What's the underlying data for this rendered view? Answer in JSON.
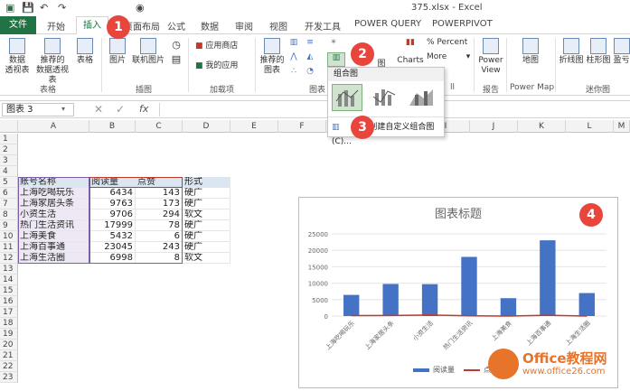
{
  "window": {
    "title": "375.xlsx - Excel"
  },
  "tabs": [
    {
      "label": "文件",
      "key": "file"
    },
    {
      "label": "开始",
      "key": "home"
    },
    {
      "label": "插入",
      "key": "insert"
    },
    {
      "label": "页面布局",
      "key": "layout"
    },
    {
      "label": "公式",
      "key": "formulas"
    },
    {
      "label": "数据",
      "key": "data"
    },
    {
      "label": "审阅",
      "key": "review"
    },
    {
      "label": "视图",
      "key": "view"
    },
    {
      "label": "开发工具",
      "key": "dev"
    },
    {
      "label": "POWER QUERY",
      "key": "pq"
    },
    {
      "label": "POWERPIVOT",
      "key": "pp"
    }
  ],
  "ribbon": {
    "pivot_table": "数据\n透视表",
    "recommended_pivot": "推荐的\n数据透视表",
    "table": "表格",
    "picture": "图片",
    "online_picture": "联机图片",
    "store": "应用商店",
    "my_apps": "我的应用",
    "recommended_charts": "推荐的\n图表",
    "percent": "% Percent",
    "more": "More",
    "power_view": "Power\nView",
    "map": "地图",
    "line": "折线图",
    "column": "柱形图",
    "winloss": "盈亏",
    "group_table": "表格",
    "group_illustrations": "插图",
    "group_addins": "加载项",
    "group_charts": "图表",
    "group_report": "报告",
    "group_powermap": "Power Map",
    "group_sparklines": "迷你图",
    "charts_label": "Charts",
    "partial_1": "ll",
    "partial_2": "图"
  },
  "formula_bar": {
    "name_box": "图表 3",
    "fx": "fx"
  },
  "columns": [
    "A",
    "B",
    "C",
    "D",
    "E",
    "F",
    "G",
    "H",
    "I",
    "J",
    "K",
    "L",
    "M"
  ],
  "rows": [
    "1",
    "2",
    "3",
    "4",
    "5",
    "6",
    "7",
    "8",
    "9",
    "10",
    "11",
    "12",
    "13",
    "14",
    "15",
    "16",
    "17",
    "18",
    "19",
    "20",
    "21",
    "22",
    "23"
  ],
  "table": {
    "headers": [
      "账号名称",
      "阅读量",
      "点赞",
      "形式"
    ],
    "rows": [
      [
        "上海吃喝玩乐",
        "6434",
        "143",
        "硬广"
      ],
      [
        "上海家居头条",
        "9763",
        "173",
        "硬广"
      ],
      [
        "小资生活",
        "9706",
        "294",
        "软文"
      ],
      [
        "热门生活资讯",
        "17999",
        "78",
        "硬广"
      ],
      [
        "上海美食",
        "5432",
        "6",
        "硬广"
      ],
      [
        "上海百事通",
        "23045",
        "243",
        "硬广"
      ],
      [
        "上海生活圈",
        "6998",
        "8",
        "软文"
      ]
    ]
  },
  "dropdown": {
    "title": "组合图",
    "custom_combo": "创建自定义组合图(C)..."
  },
  "badges": [
    "1",
    "2",
    "3",
    "4"
  ],
  "chart_data": {
    "type": "bar",
    "title": "图表标题",
    "categories": [
      "上海吃喝玩乐",
      "上海家居头条",
      "小资生活",
      "热门生活资讯",
      "上海美食",
      "上海百事通",
      "上海生活圈"
    ],
    "series": [
      {
        "name": "阅读量",
        "values": [
          6434,
          9763,
          9706,
          17999,
          5432,
          23045,
          6998
        ],
        "color": "#4472c4"
      },
      {
        "name": "点赞",
        "values": [
          143,
          173,
          294,
          78,
          6,
          243,
          8
        ],
        "color": "#c0392b",
        "type": "line"
      }
    ],
    "ylim": [
      0,
      25000
    ],
    "yticks": [
      "0",
      "5000",
      "10000",
      "15000",
      "20000",
      "25000"
    ],
    "legend": "bottom"
  },
  "watermark": {
    "brand": "Office教程网",
    "url": "www.office26.com"
  },
  "colors": {
    "accent": "#217346",
    "badge": "#e8453c",
    "bar": "#4472c4",
    "line": "#c0392b"
  }
}
